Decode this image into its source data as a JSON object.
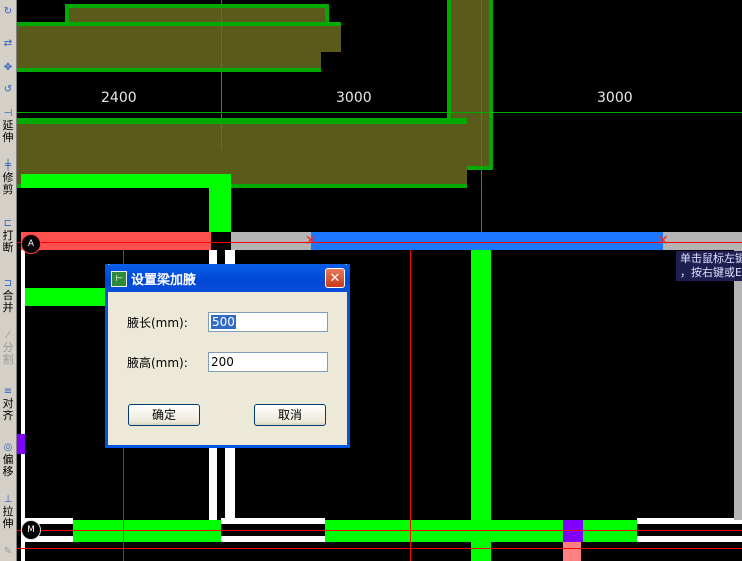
{
  "toolbar": {
    "items": [
      {
        "label": "延伸",
        "icon": "extend-icon",
        "enabled": true
      },
      {
        "label": "修剪",
        "icon": "trim-icon",
        "enabled": true
      },
      {
        "label": "打断",
        "icon": "break-icon",
        "enabled": true
      },
      {
        "label": "合并",
        "icon": "merge-icon",
        "enabled": true
      },
      {
        "label": "分割",
        "icon": "split-icon",
        "enabled": false
      },
      {
        "label": "对齐",
        "icon": "align-icon",
        "enabled": true
      },
      {
        "label": "偏移",
        "icon": "offset-icon",
        "enabled": true
      },
      {
        "label": "拉伸",
        "icon": "stretch-icon",
        "enabled": true
      }
    ]
  },
  "canvas": {
    "dimensions": [
      "2400",
      "3000",
      "3000"
    ],
    "axis_badges": [
      "A",
      "M"
    ],
    "status_tip": {
      "line1": "单击鼠标左键",
      "line2": "，按右键或Es"
    },
    "colors": {
      "background": "#000000",
      "wall_green": "#00ff00",
      "slab_olive": "#5a5a1a",
      "beam_red": "#ff5050",
      "beam_blue": "#1e78ff",
      "beam_gray": "#b4b4b4",
      "axis_line": "#ff0000"
    }
  },
  "dialog": {
    "title": "设置梁加腋",
    "fields": [
      {
        "label": "腋长(mm):",
        "value": "500"
      },
      {
        "label": "腋高(mm):",
        "value": "200"
      }
    ],
    "ok_label": "确定",
    "cancel_label": "取消",
    "close_symbol": "✕"
  }
}
